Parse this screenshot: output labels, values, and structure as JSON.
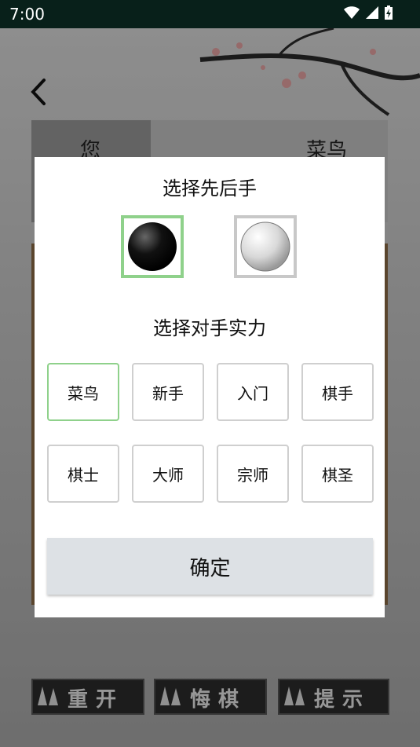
{
  "status_bar": {
    "time": "7:00"
  },
  "players": {
    "left_name": "您",
    "right_name": "菜鸟"
  },
  "dialog": {
    "title_order": "选择先后手",
    "title_level": "选择对手实力",
    "stones": [
      {
        "label": "black-stone",
        "selected": true
      },
      {
        "label": "white-stone",
        "selected": false
      }
    ],
    "levels": [
      "菜鸟",
      "新手",
      "入门",
      "棋手",
      "棋士",
      "大师",
      "宗师",
      "棋圣"
    ],
    "selected_level": "菜鸟",
    "confirm_label": "确定"
  },
  "bottom_bar": {
    "restart": "重开",
    "undo": "悔棋",
    "hint": "提示"
  },
  "colors": {
    "selected_border": "#8fd18b",
    "confirm_bg": "#dde1e5",
    "statusbar_bg": "#08201a"
  }
}
